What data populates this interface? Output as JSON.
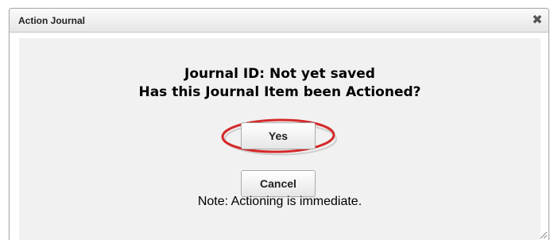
{
  "dialog": {
    "title": "Action Journal",
    "close_glyph": "✖",
    "close_icon": "close-icon",
    "resize_icon": "resize-grip-icon"
  },
  "content": {
    "heading_line1": "Journal ID: Not yet saved",
    "heading_line2": "Has this Journal Item been Actioned?",
    "yes_label": "Yes",
    "cancel_label": "Cancel",
    "note": "Note: Actioning is immediate."
  },
  "colors": {
    "content_background": "#f1f1f1",
    "highlight_ring": "#d42a2a",
    "titlebar_gradient_top": "#fafafa",
    "titlebar_gradient_bottom": "#e6e6e6"
  }
}
